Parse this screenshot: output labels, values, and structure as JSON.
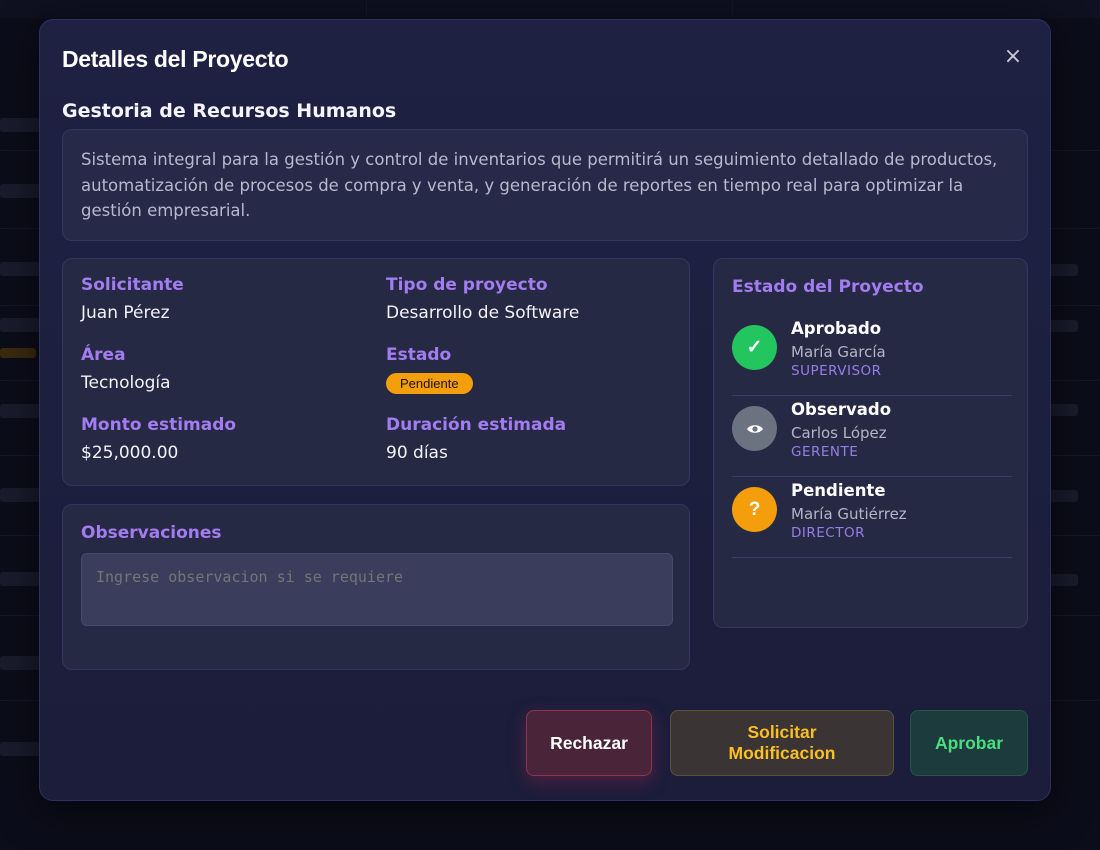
{
  "modal": {
    "title": "Detalles del Proyecto",
    "close_glyph": "×"
  },
  "project": {
    "name": "Gestoria de Recursos Humanos",
    "description": "Sistema integral para la gestión y control de inventarios que permitirá un seguimiento detallado de productos, automatización de procesos de compra y venta, y generación de reportes en tiempo real para optimizar la gestión empresarial."
  },
  "info": {
    "solicitante": {
      "label": "Solicitante",
      "value": "Juan Pérez"
    },
    "tipo": {
      "label": "Tipo de proyecto",
      "value": "Desarrollo de Software"
    },
    "area": {
      "label": "Área",
      "value": "Tecnología"
    },
    "estado": {
      "label": "Estado",
      "value": "Pendiente"
    },
    "monto": {
      "label": "Monto estimado",
      "value": "$25,000.00"
    },
    "duracion": {
      "label": "Duración estimada",
      "value": "90 días"
    }
  },
  "observaciones": {
    "label": "Observaciones",
    "placeholder": "Ingrese observacion si se requiere",
    "value": ""
  },
  "status_panel": {
    "title": "Estado del Proyecto",
    "items": [
      {
        "status": "Aprobado",
        "person": "María García",
        "role": "SUPERVISOR",
        "icon": "check-icon",
        "glyph": "✓",
        "color": "#22c55e"
      },
      {
        "status": "Observado",
        "person": "Carlos López",
        "role": "GERENTE",
        "icon": "eye-icon",
        "glyph": "",
        "color": "#6b7280"
      },
      {
        "status": "Pendiente",
        "person": "María Gutiérrez",
        "role": "DIRECTOR",
        "icon": "question-icon",
        "glyph": "?",
        "color": "#f59e0b"
      }
    ]
  },
  "actions": {
    "reject": "Rechazar",
    "modify_line1": "Solicitar",
    "modify_line2": "Modificacion",
    "approve": "Aprobar"
  },
  "colors": {
    "accent_label": "#a27cf0",
    "pending_badge": "#f59e0b",
    "approve_text": "#4ade80",
    "modify_text": "#fbbf24"
  }
}
